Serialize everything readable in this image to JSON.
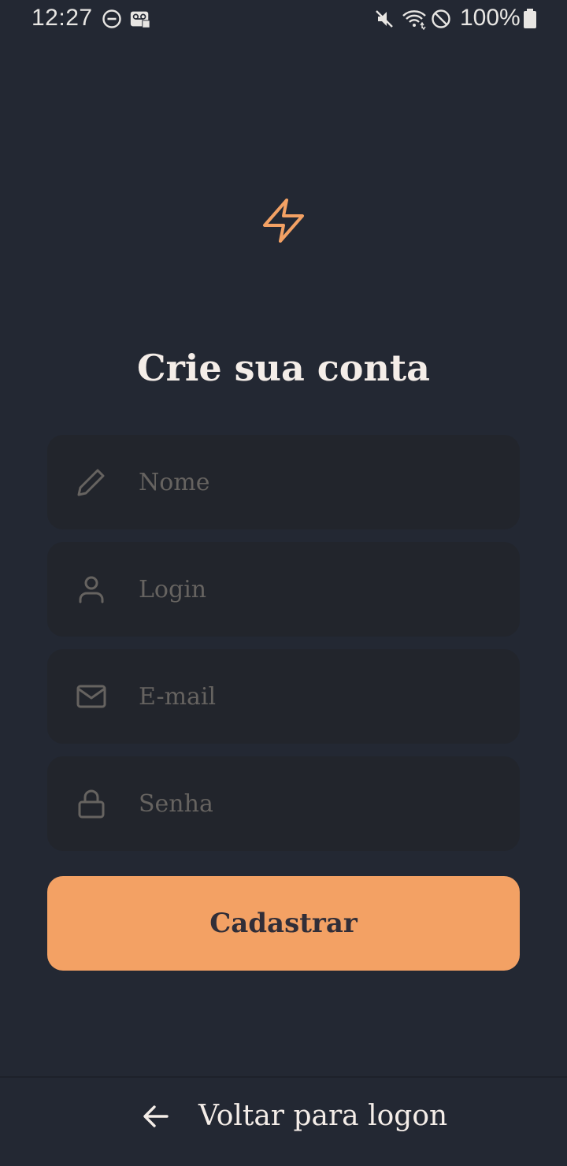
{
  "status_bar": {
    "time": "12:27",
    "battery": "100%"
  },
  "logo": {
    "icon": "zap-icon",
    "color": "#f3a164"
  },
  "form": {
    "title": "Crie sua conta",
    "fields": [
      {
        "icon": "edit-icon",
        "placeholder": "Nome"
      },
      {
        "icon": "user-icon",
        "placeholder": "Login"
      },
      {
        "icon": "mail-icon",
        "placeholder": "E-mail"
      },
      {
        "icon": "lock-icon",
        "placeholder": "Senha"
      }
    ],
    "submit_label": "Cadastrar"
  },
  "footer": {
    "back_label": "Voltar para logon",
    "back_icon": "arrow-left-icon"
  },
  "colors": {
    "background": "#232833",
    "input_background": "#22252c",
    "accent": "#f3a164",
    "text": "#f4ede8",
    "placeholder": "#666360"
  }
}
